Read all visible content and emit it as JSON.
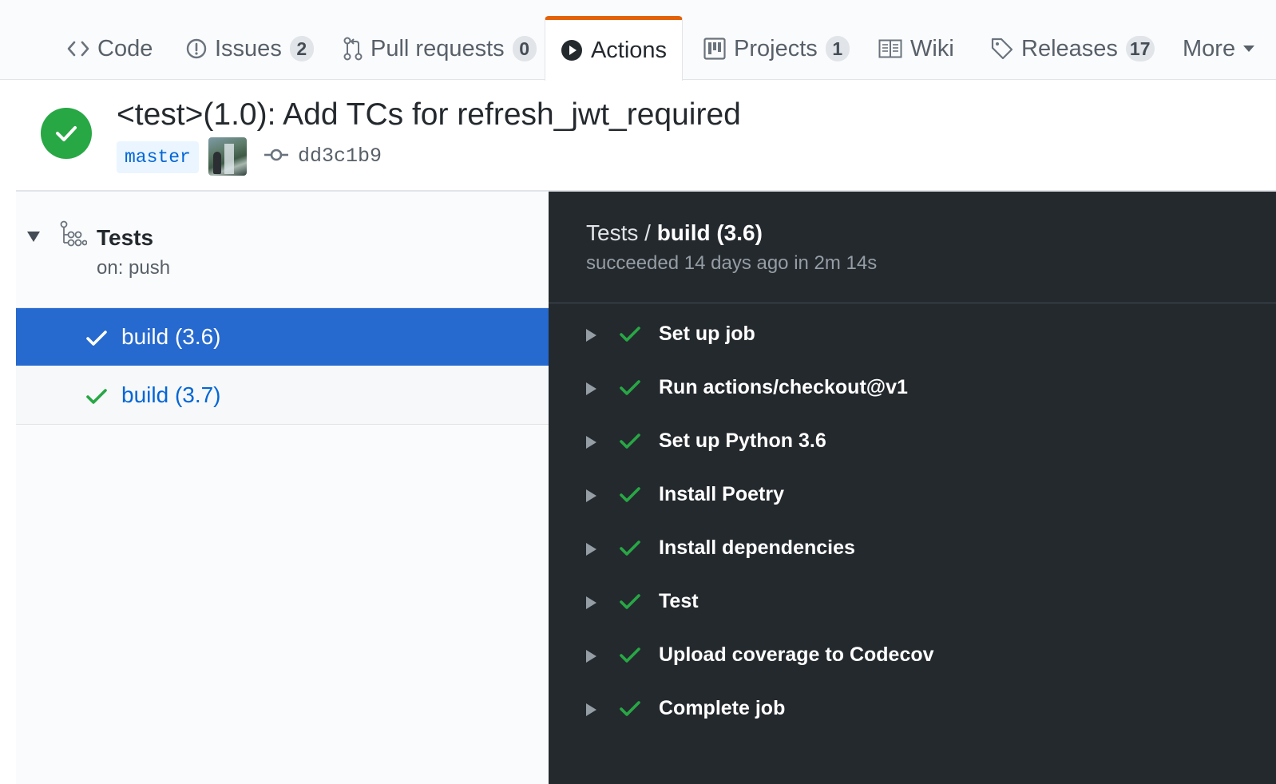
{
  "tabs": [
    {
      "label": "Code",
      "icon": "code-icon"
    },
    {
      "label": "Issues",
      "count": "2",
      "icon": "issue-icon"
    },
    {
      "label": "Pull requests",
      "count": "0",
      "icon": "pull-request-icon"
    },
    {
      "label": "Actions",
      "icon": "play-icon",
      "selected": true
    },
    {
      "label": "Projects",
      "count": "1",
      "icon": "project-icon"
    },
    {
      "label": "Wiki",
      "icon": "book-icon"
    },
    {
      "label": "Releases",
      "count": "17",
      "icon": "tag-icon"
    },
    {
      "label": "More",
      "icon": "caret-down-icon"
    }
  ],
  "run": {
    "title": "<test>(1.0): Add TCs for refresh_jwt_required",
    "status": "success",
    "branch": "master",
    "commit": "dd3c1b9"
  },
  "workflow": {
    "name": "Tests",
    "trigger": "on: push"
  },
  "jobs": [
    {
      "label": "build (3.6)",
      "selected": true
    },
    {
      "label": "build (3.7)",
      "selected": false
    }
  ],
  "log": {
    "workflow": "Tests",
    "separator": "/",
    "job": "build (3.6)",
    "summary": "succeeded 14 days ago in 2m 14s",
    "steps": [
      "Set up job",
      "Run actions/checkout@v1",
      "Set up Python 3.6",
      "Install Poetry",
      "Install dependencies",
      "Test",
      "Upload coverage to Codecov",
      "Complete job"
    ]
  },
  "colors": {
    "success": "#28a745",
    "accent_tab": "#e36209",
    "selected_job": "#2669cf",
    "log_bg": "#24292e",
    "link": "#0366d6"
  }
}
